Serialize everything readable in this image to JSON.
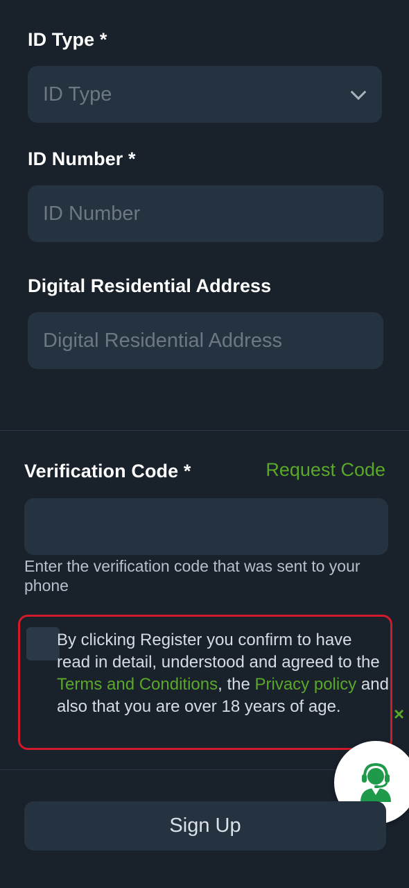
{
  "id_type": {
    "label": "ID Type *",
    "placeholder": "ID Type"
  },
  "id_number": {
    "label": "ID Number *",
    "placeholder": "ID Number"
  },
  "address": {
    "label": "Digital Residential Address",
    "placeholder": "Digital Residential Address"
  },
  "verification": {
    "label": "Verification Code *",
    "request_label": "Request Code",
    "value": "",
    "helper": "Enter the verification code that was sent to your phone"
  },
  "terms": {
    "part1": "By clicking Register you confirm to have read in detail, understood and agreed to the ",
    "terms_link": "Terms and Conditions",
    "part2": ", the ",
    "privacy_link": "Privacy policy",
    "part3": " and also that you are over 18 years of age.",
    "checked": false
  },
  "close_glyph": "×",
  "signup_label": "Sign Up",
  "colors": {
    "background": "#19212b",
    "field": "#253240",
    "accent": "#5aa829",
    "highlight_border": "#d11a2a"
  },
  "icons": {
    "support": "headset-agent-icon",
    "dropdown": "chevron-down-icon"
  }
}
